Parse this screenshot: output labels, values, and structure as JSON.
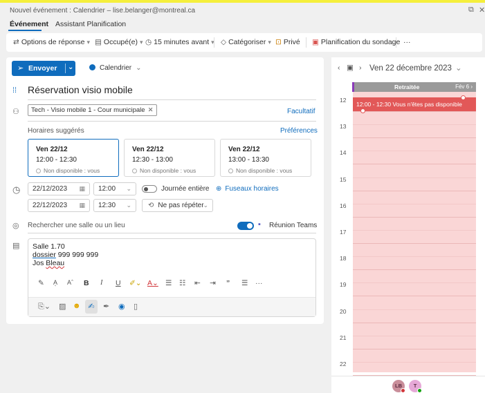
{
  "window": {
    "title": "Nouvel événement : Calendrier – lise.belanger@montreal.ca"
  },
  "tabs": [
    {
      "label": "Événement"
    },
    {
      "label": "Assistant Planification"
    }
  ],
  "ribbon": {
    "response_options": "Options de réponse",
    "status": "Occupé(e)",
    "reminder": "15 minutes avant",
    "categorize": "Catégoriser",
    "private": "Privé",
    "poll": "Planification du sondage",
    "more": "···"
  },
  "form": {
    "send_label": "Envoyer",
    "calendar_label": "Calendrier",
    "title": "Réservation visio mobile",
    "attendee": "Tech - Visio mobile 1 - Cour municipale",
    "optional_link": "Facultatif",
    "suggested_label": "Horaires suggérés",
    "preferences_link": "Préférences",
    "suggestions": [
      {
        "date": "Ven 22/12",
        "time": "12:00 - 12:30",
        "status": "Non disponible : vous"
      },
      {
        "date": "Ven 22/12",
        "time": "12:30 - 13:00",
        "status": "Non disponible : vous"
      },
      {
        "date": "Ven 22/12",
        "time": "13:00 - 13:30",
        "status": "Non disponible : vous"
      }
    ],
    "start_date": "22/12/2023",
    "start_time": "12:00",
    "end_date": "22/12/2023",
    "end_time": "12:30",
    "all_day_label": "Journée entière",
    "timezones_link": "Fuseaux horaires",
    "repeat_label": "Ne pas répéter",
    "location_placeholder": "Rechercher une salle ou un lieu",
    "teams_label": "Réunion Teams",
    "body": {
      "line1": "Salle 1.70",
      "line2a": "dossier",
      "line2b": " 999 999 999",
      "line3a": "Jos ",
      "line3b": "Bleau"
    }
  },
  "calendar": {
    "date_label": "Ven 22 décembre 2023",
    "retraitee_label": "Retraitée",
    "next_label": "Fév 6",
    "event_label": "12:00 - 12:30  Vous n'êtes pas disponible",
    "hours": [
      "12",
      "13",
      "14",
      "15",
      "16",
      "17",
      "18",
      "19",
      "20",
      "21",
      "22"
    ]
  },
  "avatars": [
    {
      "initials": "LB",
      "color": "#c98e9a",
      "badge_color": "#d13438"
    },
    {
      "initials": "T",
      "color": "#e6a8d7",
      "badge_color": "#13a10e"
    }
  ],
  "colors": {
    "accent": "#0f6cbd",
    "busy_block": "#e25858",
    "busy_area": "#fad6d6"
  }
}
